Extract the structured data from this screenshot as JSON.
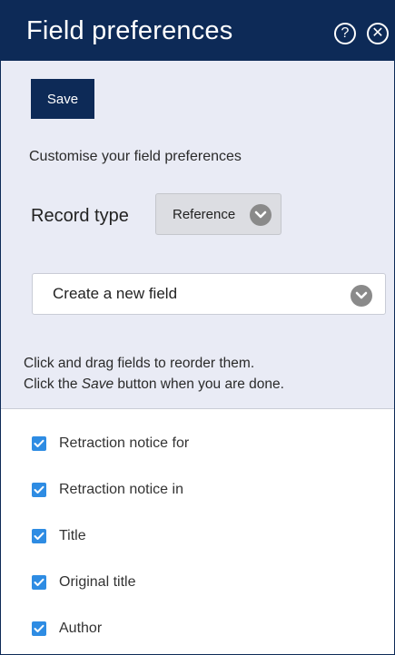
{
  "header": {
    "title": "Field preferences",
    "help_icon": "question-circle-icon",
    "close_icon": "close-circle-icon",
    "help_glyph": "?",
    "close_glyph": "✕"
  },
  "toolbar": {
    "save_label": "Save"
  },
  "intro_text": "Customise your field preferences",
  "record_type": {
    "label": "Record type",
    "selected": "Reference",
    "icon": "chevron-down-circle-icon"
  },
  "new_field": {
    "selected": "Create a new field",
    "icon": "chevron-down-circle-icon"
  },
  "help": {
    "line1": "Click and drag fields to reorder them.",
    "line2_prefix": "Click the ",
    "line2_emphasis": "Save",
    "line2_suffix": " button when you are done."
  },
  "fields": [
    {
      "label": "Retraction notice for",
      "checked": true
    },
    {
      "label": "Retraction notice in",
      "checked": true
    },
    {
      "label": "Title",
      "checked": true
    },
    {
      "label": "Original title",
      "checked": true
    },
    {
      "label": "Author",
      "checked": true
    }
  ],
  "colors": {
    "header_bg": "#0d2a57",
    "section_bg": "#e9ebf5",
    "checkbox": "#2e8ce3"
  }
}
